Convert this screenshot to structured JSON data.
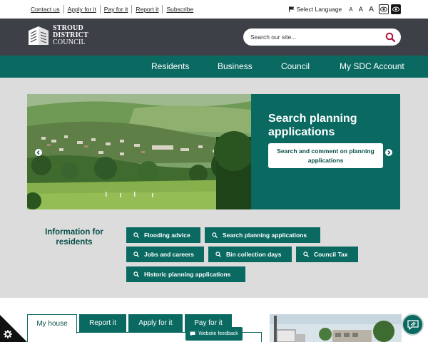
{
  "top_links": [
    "Contact us",
    "Apply for it",
    "Pay for it",
    "Report it",
    "Subscribe"
  ],
  "accessibility": {
    "language_label": "Select Language",
    "font_sizes": [
      "A",
      "A",
      "A"
    ]
  },
  "header": {
    "logo_lines": [
      "STROUD",
      "DISTRICT",
      "COUNCIL"
    ],
    "search_placeholder": "Search our site..."
  },
  "nav": [
    "Residents",
    "Business",
    "Council",
    "My SDC Account"
  ],
  "hero": {
    "title": "Search planning applications",
    "button_label": "Search and comment on planning applications"
  },
  "info": {
    "title": "Information for residents",
    "links": [
      "Flooding advice",
      "Search planning applications",
      "Jobs and careers",
      "Bin collection days",
      "Council Tax",
      "Historic planning applications"
    ]
  },
  "tabs": [
    "My house",
    "Report it",
    "Apply for it",
    "Pay for it"
  ],
  "feedback_label": "Website feedback",
  "colors": {
    "primary": "#0a6a62",
    "header": "#3d4047",
    "background": "#dcdcdc"
  }
}
